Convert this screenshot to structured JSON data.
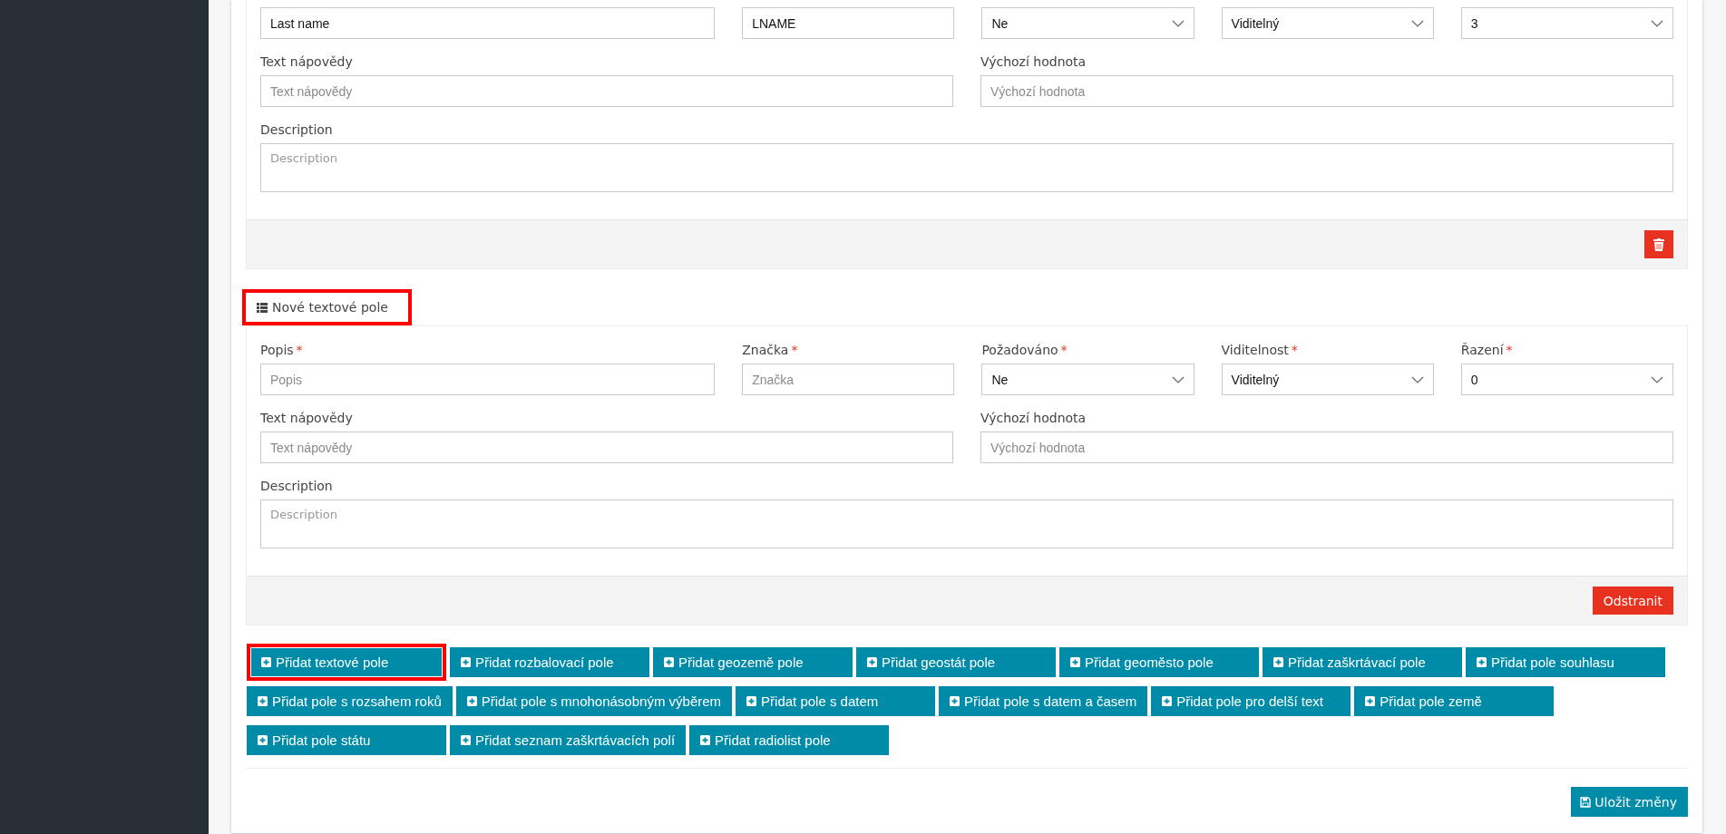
{
  "sections": [
    {
      "rows": [
        {
          "kind": "main",
          "fields": [
            {
              "kind": "input",
              "value": "Last name"
            },
            {
              "kind": "input",
              "value": "LNAME"
            },
            {
              "kind": "select",
              "value": "Ne"
            },
            {
              "kind": "select",
              "value": "Viditelný"
            },
            {
              "kind": "select",
              "value": "3"
            }
          ]
        },
        {
          "kind": "pair",
          "fields": [
            {
              "kind": "input",
              "label": "Text nápovědy",
              "placeholder": "Text nápovědy"
            },
            {
              "kind": "input",
              "label": "Výchozí hodnota",
              "placeholder": "Výchozí hodnota"
            }
          ]
        },
        {
          "kind": "wide",
          "fields": [
            {
              "kind": "textarea",
              "label": "Description",
              "placeholder": "Description"
            }
          ]
        }
      ],
      "footer_button": {
        "kind": "icon"
      }
    },
    {
      "header": {
        "label": "Nové textové pole",
        "highlighted": true
      },
      "rows": [
        {
          "kind": "main",
          "fields": [
            {
              "kind": "input",
              "label": "Popis",
              "required_mark": "*",
              "placeholder": "Popis"
            },
            {
              "kind": "input",
              "label": "Značka",
              "required_mark": "*",
              "placeholder": "Značka"
            },
            {
              "kind": "select",
              "label": "Požadováno",
              "required_mark": "*",
              "value": "Ne"
            },
            {
              "kind": "select",
              "label": "Viditelnost",
              "required_mark": "*",
              "value": "Viditelný"
            },
            {
              "kind": "select",
              "label": "Řazení",
              "required_mark": "*",
              "value": "0"
            }
          ]
        },
        {
          "kind": "pair",
          "fields": [
            {
              "kind": "input",
              "label": "Text nápovědy",
              "placeholder": "Text nápovědy"
            },
            {
              "kind": "input",
              "label": "Výchozí hodnota",
              "placeholder": "Výchozí hodnota"
            }
          ]
        },
        {
          "kind": "wide",
          "fields": [
            {
              "kind": "textarea",
              "label": "Description",
              "placeholder": "Description"
            }
          ]
        }
      ],
      "footer_button": {
        "kind": "text",
        "label": "Odstranit"
      }
    }
  ],
  "add_buttons": [
    {
      "label": "Přidat textové pole",
      "highlighted": true
    },
    {
      "label": "Přidat rozbalovací pole",
      "highlighted": false
    },
    {
      "label": "Přidat geozemě pole",
      "highlighted": false
    },
    {
      "label": "Přidat geostát pole",
      "highlighted": false
    },
    {
      "label": "Přidat geoměsto pole",
      "highlighted": false
    },
    {
      "label": "Přidat zaškrtávací pole",
      "highlighted": false
    },
    {
      "label": "Přidat pole souhlasu",
      "highlighted": false
    },
    {
      "label": "Přidat pole s rozsahem roků",
      "highlighted": false
    },
    {
      "label": "Přidat pole s mnohonásobným výběrem",
      "highlighted": false
    },
    {
      "label": "Přidat pole s datem",
      "highlighted": false
    },
    {
      "label": "Přidat pole s datem a časem",
      "highlighted": false
    },
    {
      "label": "Přidat pole pro delší text",
      "highlighted": false
    },
    {
      "label": "Přidat pole země",
      "highlighted": false
    },
    {
      "label": "Přidat pole státu",
      "highlighted": false
    },
    {
      "label": "Přidat seznam zaškrtávacích polí",
      "highlighted": false
    },
    {
      "label": "Přidat radiolist pole",
      "highlighted": false
    }
  ],
  "save_button": {
    "label": "Uložit změny"
  }
}
